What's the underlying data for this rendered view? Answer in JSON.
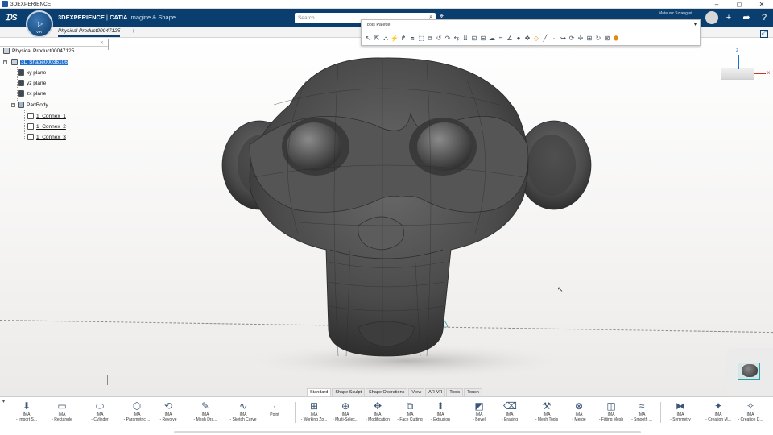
{
  "window": {
    "title": "3DEXPERIENCE",
    "controls": [
      "–",
      "◻",
      "✕"
    ]
  },
  "topbar": {
    "brand_bold": "3DEXPERIENCE",
    "brand_sep": " | ",
    "brand_app": "CATIA",
    "brand_sub": " Imagine & Shape",
    "search_placeholder": "Search",
    "user": "Mateusz Sztangret",
    "compass_label": "V,R"
  },
  "tabs": {
    "active": "Physical Product00047125",
    "add": "+"
  },
  "tree": {
    "collapse_glyph": "‹",
    "root": "Physical Product00047125",
    "shape": "3D Shape00036106",
    "planes": [
      "xy plane",
      "yz plane",
      "zx plane"
    ],
    "body": "PartBody",
    "sketches": [
      "1_Connex_1",
      "1_Connex_2",
      "1_Connex_3"
    ]
  },
  "palette": {
    "title": "Tools Palette"
  },
  "triad": {
    "z": "z",
    "x": "x"
  },
  "sections": [
    "Standard",
    "Shape Sculpt",
    "Shape Operations",
    "View",
    "AR-VR",
    "Tools",
    "Touch"
  ],
  "sections_active": "Standard",
  "actions": [
    {
      "l1": "IMA",
      "l2": "- Import S...",
      "icon": "⬇"
    },
    {
      "l1": "IMA",
      "l2": "- Rectangle",
      "icon": "▭"
    },
    {
      "l1": "IMA",
      "l2": "- Cylinder",
      "icon": "⬭"
    },
    {
      "l1": "IMA",
      "l2": "- Parametric ...",
      "icon": "⬡"
    },
    {
      "l1": "IMA",
      "l2": "- Revolve",
      "icon": "⟲"
    },
    {
      "l1": "IMA",
      "l2": "- Mesh Dra...",
      "icon": "✎"
    },
    {
      "l1": "IMA",
      "l2": "- Sketch Curve",
      "icon": "∿"
    },
    {
      "l1": "Point",
      "l2": "",
      "icon": "·"
    },
    {
      "l1": "IMA",
      "l2": "- Working Zo...",
      "icon": "⊞"
    },
    {
      "l1": "IMA",
      "l2": "- Multi-Selec...",
      "icon": "⊕"
    },
    {
      "l1": "IMA",
      "l2": "- Modification",
      "icon": "✥"
    },
    {
      "l1": "IMA",
      "l2": "- Face Cutting",
      "icon": "⧉"
    },
    {
      "l1": "IMA",
      "l2": "- Extrusion",
      "icon": "⬆"
    },
    {
      "l1": "IMA",
      "l2": "- Bevel",
      "icon": "◩"
    },
    {
      "l1": "IMA",
      "l2": "- Erasing",
      "icon": "⌫"
    },
    {
      "l1": "IMA",
      "l2": "- Mesh Tools",
      "icon": "⚒"
    },
    {
      "l1": "IMA",
      "l2": "- Merge",
      "icon": "⊗"
    },
    {
      "l1": "IMA",
      "l2": "- Fitting Mesh",
      "icon": "◫"
    },
    {
      "l1": "IMA",
      "l2": "- Smooth ...",
      "icon": "≈"
    },
    {
      "l1": "IMA",
      "l2": "- Symmetry",
      "icon": "⧓"
    },
    {
      "l1": "IMA",
      "l2": "- Creation M...",
      "icon": "✦"
    },
    {
      "l1": "IMA",
      "l2": "- Creation D...",
      "icon": "✧"
    }
  ],
  "colors": {
    "topbar": "#0a3e6e",
    "selection": "#1c6fd0",
    "accent_orange": "#e08a14"
  }
}
